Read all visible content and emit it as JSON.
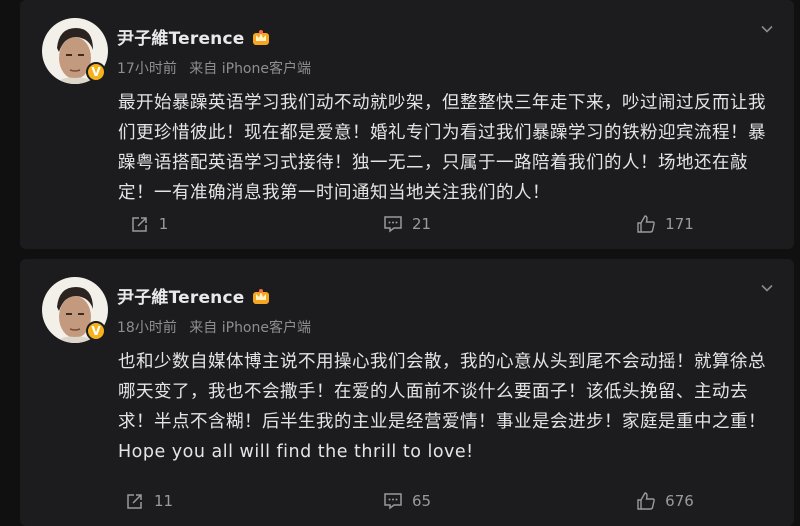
{
  "posts": [
    {
      "author": "尹子維Terence",
      "time": "17小时前",
      "source": "来自 iPhone客户端",
      "text": "最开始暴躁英语学习我们动不动就吵架，但整整快三年走下来，吵过闹过反而让我们更珍惜彼此！现在都是爱意！婚礼专门为看过我们暴躁学习的铁粉迎宾流程！暴躁粤语搭配英语学习式接待！独一无二，只属于一路陪着我们的人！场地还在敲定！一有准确消息我第一时间通知当地关注我们的人！",
      "repost_count": "1",
      "comment_count": "21",
      "like_count": "171"
    },
    {
      "author": "尹子維Terence",
      "time": "18小时前",
      "source": "来自 iPhone客户端",
      "text": "也和少数自媒体博主说不用操心我们会散，我的心意从头到尾不会动摇！就算徐总哪天变了，我也不会撒手！在爱的人面前不谈什么要面子！该低头挽留、主动去求！半点不含糊！后半生我的主业是经营爱情！事业是会进步！家庭是重中之重！Hope you all will find the thrill to love!",
      "repost_count": "11",
      "comment_count": "65",
      "like_count": "676"
    }
  ],
  "verified_badge": "V",
  "colors": {
    "background": "#101010",
    "card": "#1c1c1e",
    "text": "#e4e4e4",
    "meta": "#8e8e8e",
    "badge": "#f6b21b"
  }
}
